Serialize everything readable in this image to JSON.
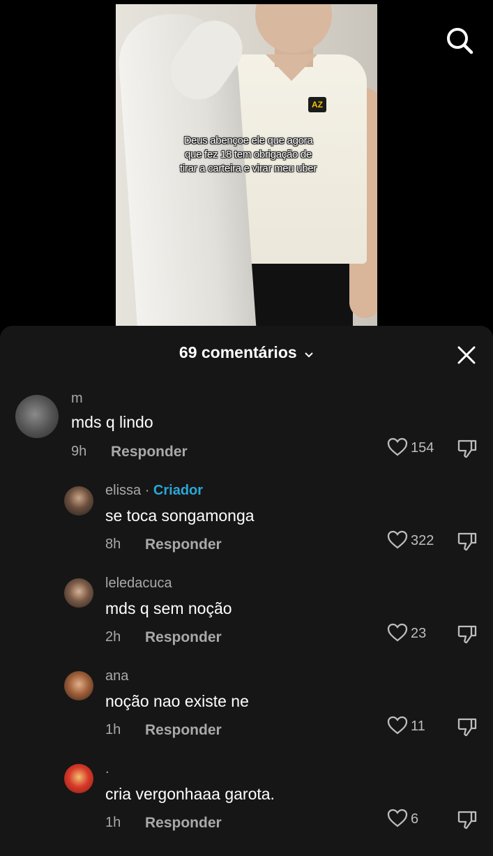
{
  "video": {
    "caption": "Deus abençoe ele que agora que fez 18 tem obrigação de tirar a carteira e virar meu uber",
    "shirt_logo": "AZ"
  },
  "icons": {
    "search": "search-icon",
    "close": "close-icon",
    "chevron": "chevron-down-icon",
    "like": "heart-icon",
    "dislike": "dislike-icon"
  },
  "comments_panel": {
    "title": "69 comentários",
    "reply_label": "Responder",
    "comments": [
      {
        "user": "m",
        "badge": "",
        "text": "mds q lindo",
        "time": "9h",
        "likes": "154"
      },
      {
        "user": "elissa",
        "badge": "Criador",
        "text": "se toca songamonga",
        "time": "8h",
        "likes": "322"
      },
      {
        "user": "leledacuca",
        "badge": "",
        "text": "mds q sem noção",
        "time": "2h",
        "likes": "23"
      },
      {
        "user": "ana",
        "badge": "",
        "text": "noção nao existe ne",
        "time": "1h",
        "likes": "11"
      },
      {
        "user": ".",
        "badge": "",
        "text": "cria vergonhaaa garota.",
        "time": "1h",
        "likes": "6"
      }
    ]
  },
  "colors": {
    "background": "#000000",
    "sheet": "#161616",
    "secondary_text": "#a9a9a9",
    "creator_badge": "#2aa7d8"
  }
}
